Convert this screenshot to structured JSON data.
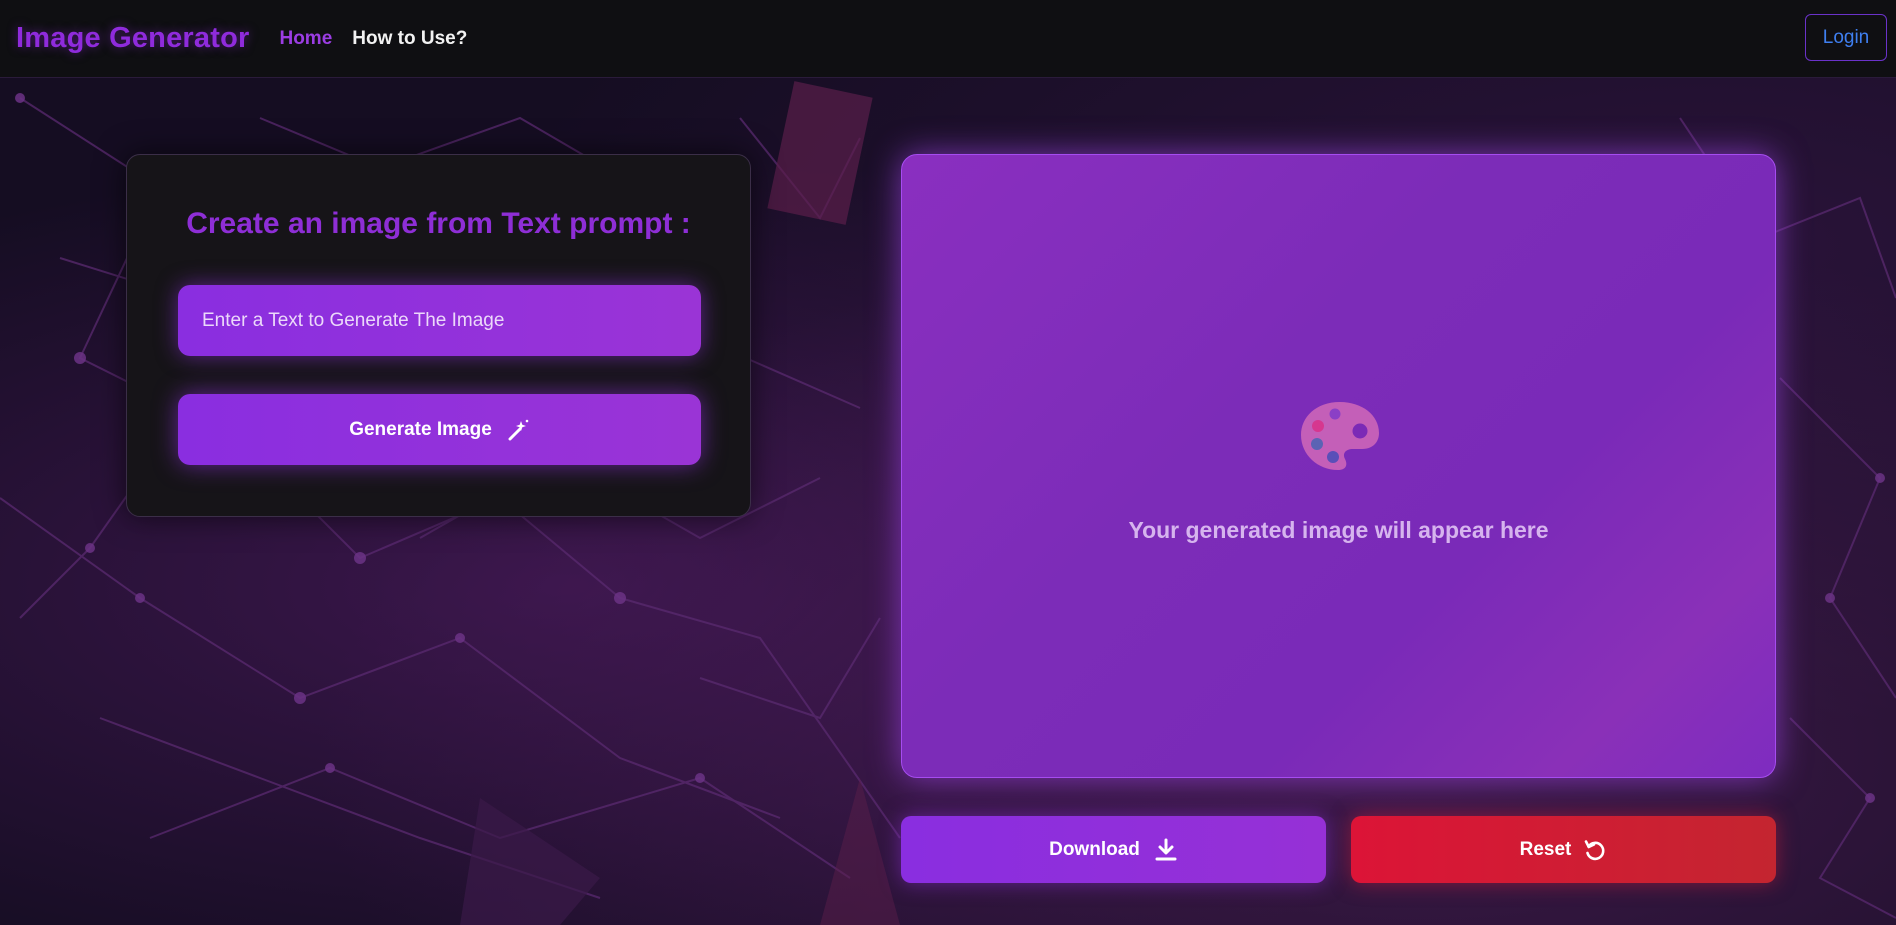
{
  "header": {
    "brand": "Image Generator",
    "nav": [
      {
        "label": "Home",
        "active": true
      },
      {
        "label": "How to Use?",
        "active": false
      }
    ],
    "login_label": "Login"
  },
  "prompt_card": {
    "title": "Create an image from Text prompt :",
    "input_placeholder": "Enter a Text to Generate The Image",
    "input_value": "",
    "generate_label": "Generate Image",
    "generate_icon": "magic-wand-icon"
  },
  "preview": {
    "icon": "palette-icon",
    "placeholder_text": "Your generated image will appear here"
  },
  "actions": {
    "download_label": "Download",
    "download_icon": "download-icon",
    "reset_label": "Reset",
    "reset_icon": "refresh-icon"
  },
  "colors": {
    "accent": "#8f2bdc",
    "reset": "#dc1437",
    "login_text": "#3f7ff0"
  }
}
